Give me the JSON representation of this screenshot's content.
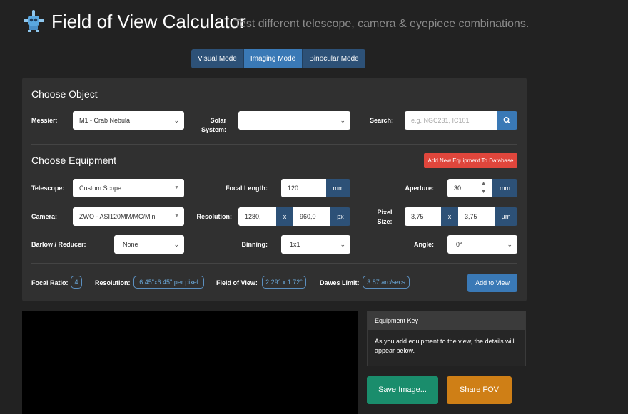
{
  "header": {
    "title": "Field of View Calculator",
    "subtitle": "Test different telescope, camera & eyepiece combinations."
  },
  "modes": [
    {
      "label": "Visual Mode",
      "active": false
    },
    {
      "label": "Imaging Mode",
      "active": true
    },
    {
      "label": "Binocular Mode",
      "active": false
    }
  ],
  "object": {
    "heading": "Choose Object",
    "messier_label": "Messier:",
    "messier_value": "M1 - Crab Nebula",
    "solar_label_1": "Solar",
    "solar_label_2": "System:",
    "solar_value": "",
    "search_label": "Search:",
    "search_placeholder": "e.g. NGC231, IC101"
  },
  "equipment": {
    "heading": "Choose Equipment",
    "add_button": "Add New Equipment To Database",
    "telescope_label": "Telescope:",
    "telescope_value": "Custom Scope",
    "focal_length_label": "Focal Length:",
    "focal_length_value": "120",
    "focal_length_unit": "mm",
    "aperture_label": "Aperture:",
    "aperture_value": "30",
    "aperture_unit": "mm",
    "camera_label": "Camera:",
    "camera_value": "ZWO - ASI120MM/MC/Mini",
    "resolution_label": "Resolution:",
    "res_x": "1280,",
    "res_sep": "x",
    "res_y": "960,0",
    "res_unit": "px",
    "pixel_label_1": "Pixel",
    "pixel_label_2": "Size:",
    "pix_x": "3,75",
    "pix_sep": "x",
    "pix_y": "3,75",
    "pix_unit": "µm",
    "barlow_label": "Barlow / Reducer:",
    "barlow_value": "None",
    "binning_label": "Binning:",
    "binning_value": "1x1",
    "angle_label": "Angle:",
    "angle_value": "0°"
  },
  "results": {
    "focal_ratio_label": "Focal Ratio:",
    "focal_ratio_value": "4",
    "resolution_label": "Resolution:",
    "resolution_value": "6.45\"x6.45\" per pixel",
    "fov_label": "Field of View:",
    "fov_value": "2.29° x 1.72°",
    "dawes_label": "Dawes Limit:",
    "dawes_value": "3.87 arc/secs",
    "add_to_view": "Add to View"
  },
  "key": {
    "title": "Equipment Key",
    "text": "As you add equipment to the view, the details will appear below."
  },
  "actions": {
    "save": "Save Image...",
    "share": "Share FOV"
  },
  "colors": {
    "background": "#222222",
    "panel": "#303030",
    "accent_blue": "#3a79b6",
    "dark_blue": "#2d5177",
    "red": "#e0463c",
    "green": "#1a8d6c",
    "orange": "#cf7f16"
  },
  "icons": {
    "logo": "robot-telescope-icon",
    "search": "search-icon",
    "caret": "chevron-down-icon"
  }
}
